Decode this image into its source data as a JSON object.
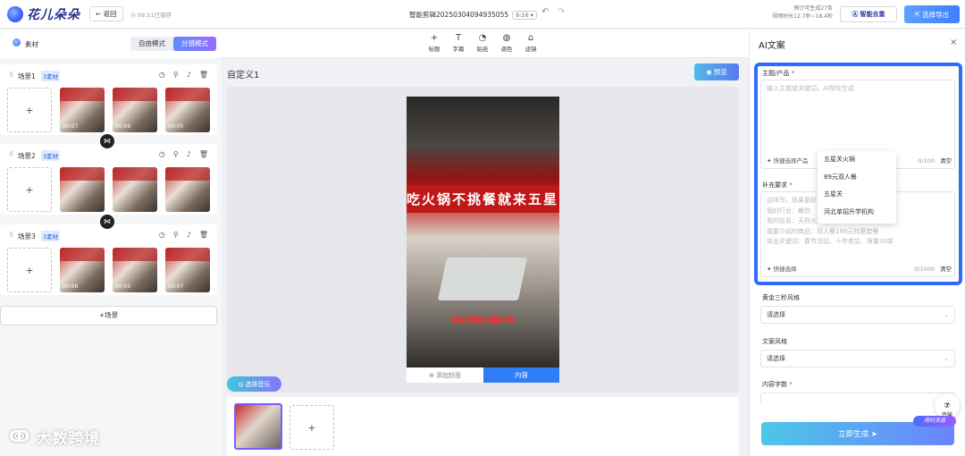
{
  "app": {
    "name": "花儿朵朵",
    "back_label": "← 返回",
    "saved_status": "09:51已保存",
    "project_title": "智能剪辑20250304094935055",
    "aspect_ratio": "9:16 ▾",
    "estimate_line1": "预计可生成27条",
    "estimate_line2": "视频时长12.7秒~18.4秒",
    "logo_button_label": "智能去重",
    "export_button_label": "选择导出",
    "accent_color": "#2f6bff"
  },
  "left_panel": {
    "material_label": "素材",
    "modes": [
      "自由模式",
      "分镜模式"
    ],
    "active_mode": "分镜模式",
    "scenes": [
      {
        "name": "场景1",
        "badge": "3素材",
        "durations": [
          "00:07",
          "00:06",
          "00:05"
        ]
      },
      {
        "name": "场景2",
        "badge": "3素材",
        "durations": [
          "",
          "",
          ""
        ]
      },
      {
        "name": "场景3",
        "badge": "3素材",
        "durations": [
          "00:06",
          "00:05",
          "00:07"
        ]
      }
    ],
    "add_slot_symbol": "+",
    "add_scene_label": "+场景"
  },
  "toolbar": {
    "items": [
      {
        "label": "标题",
        "icon": "plus-icon",
        "glyph": "+"
      },
      {
        "label": "字幕",
        "icon": "text-icon",
        "glyph": "T"
      },
      {
        "label": "贴纸",
        "icon": "sticker-icon",
        "glyph": "◔"
      },
      {
        "label": "调色",
        "icon": "palette-icon",
        "glyph": "◍"
      },
      {
        "label": "滤镜",
        "icon": "filter-icon",
        "glyph": "⌂"
      }
    ]
  },
  "canvas": {
    "title": "自定义1",
    "preview_label": "预览",
    "video_sign_text": "吃火锅不挑餐就来五星",
    "caption_text": "点击添加口播内容",
    "add_cover_label": "添加封面",
    "content_tab_label": "内容",
    "music_label": "选择音乐",
    "tray_add_symbol": "+"
  },
  "ai_panel": {
    "title": "AI文案",
    "close_glyph": "×",
    "topic_label": "主题/产品",
    "topic_placeholder": "输入主题或关键词，AI帮你生成",
    "quick_select_product": "快捷选择产品",
    "topic_count": "0/100",
    "clear_label": "清空",
    "dropdown_items": [
      "五星关火锅",
      "89元双人餐",
      "五星关",
      "河北单招升学机构"
    ],
    "supplement_label": "补充要求",
    "supplement_placeholder_lines": [
      "这样写，效果更好",
      "我的行业：餐饮",
      "我的店名：天府火锅",
      "我要介绍的商品：双人餐199元特惠套餐",
      "突出关键词：春节活动、十年老店、限量30单"
    ],
    "quick_select": "快捷选择",
    "supplement_count": "0/1000",
    "golden_label": "黄金三秒风格",
    "golden_value": "请选择",
    "style_label": "文案风格",
    "style_value": "请选择",
    "word_count_label": "内容字数",
    "generate_label": "立即生成 ➤",
    "float_upload_label": "传输",
    "mascot_label": "用时灵感"
  },
  "watermark": {
    "text": "大数跨境"
  }
}
